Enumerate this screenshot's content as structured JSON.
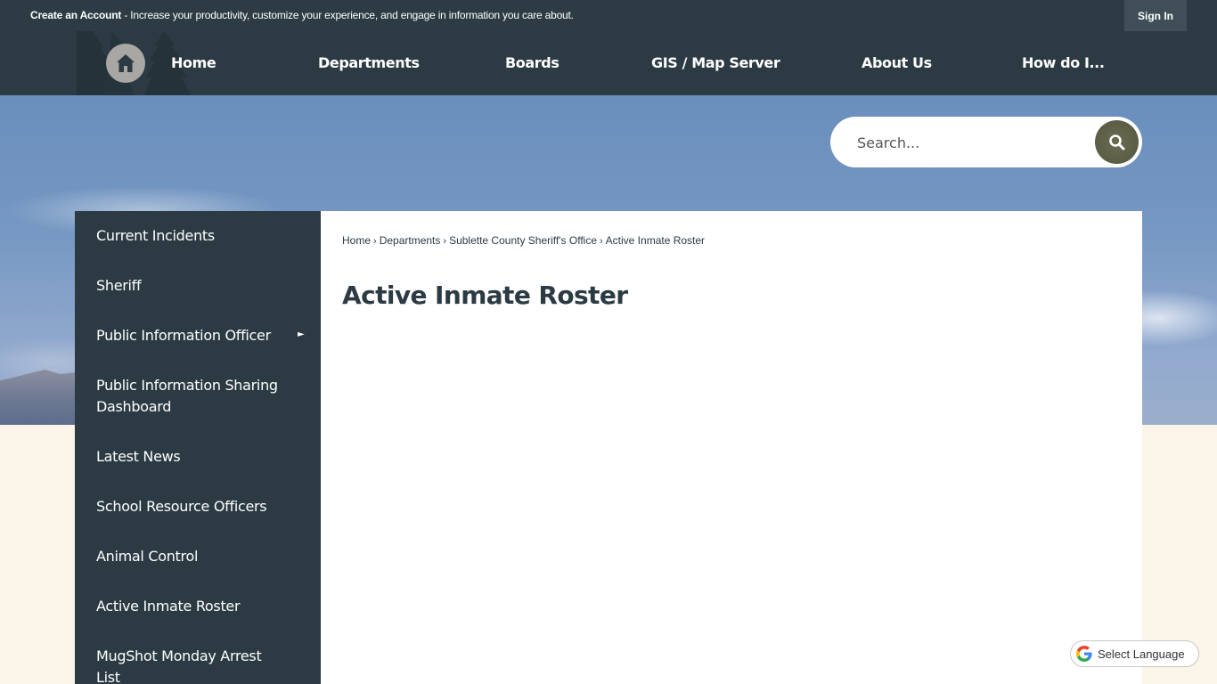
{
  "topbar": {
    "create_account_label": "Create an Account",
    "create_account_message": " - Increase your productivity, customize your experience, and engage in information you care about.",
    "sign_in_label": "Sign In"
  },
  "nav": {
    "home_icon": "home-icon",
    "items": [
      {
        "label": "Home"
      },
      {
        "label": "Departments"
      },
      {
        "label": "Boards"
      },
      {
        "label": "GIS / Map Server"
      },
      {
        "label": "About Us"
      },
      {
        "label": "How do I..."
      }
    ]
  },
  "search": {
    "placeholder": "Search...",
    "value": "",
    "button_icon": "search-icon"
  },
  "sidebar": {
    "items": [
      {
        "label": "Current Incidents"
      },
      {
        "label": "Sheriff"
      },
      {
        "label": "Public Information Officer",
        "has_submenu": true
      },
      {
        "label": "Public Information Sharing Dashboard"
      },
      {
        "label": "Latest News"
      },
      {
        "label": "School Resource Officers"
      },
      {
        "label": "Animal Control"
      },
      {
        "label": "Active Inmate Roster"
      },
      {
        "label": "MugShot Monday Arrest List"
      }
    ],
    "submenu_arrow": "►"
  },
  "breadcrumb": {
    "items": [
      "Home",
      "Departments",
      "Sublette County Sheriff's Office",
      "Active Inmate Roster"
    ],
    "separator": "›"
  },
  "page": {
    "title": "Active Inmate Roster"
  },
  "translate": {
    "label": "Select Language",
    "icon": "google-g-icon"
  },
  "colors": {
    "dark_navy": "#2b3a43",
    "sign_in_bg": "#3f4e57",
    "cream": "#fbf4e8",
    "search_button": "#5f604a"
  }
}
